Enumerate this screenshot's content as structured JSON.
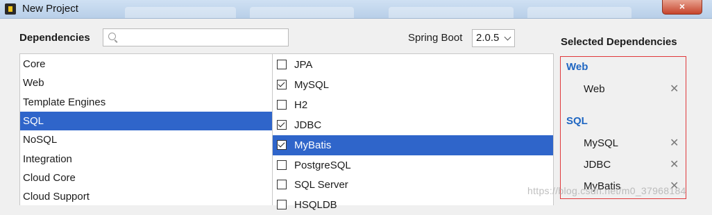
{
  "window": {
    "title": "New Project",
    "close_glyph": "×"
  },
  "header": {
    "dependencies_label": "Dependencies",
    "search": {
      "placeholder": "",
      "value": ""
    },
    "spring_boot_label": "Spring Boot",
    "spring_boot_version": "2.0.5"
  },
  "categories": [
    {
      "label": "Core",
      "selected": false
    },
    {
      "label": "Web",
      "selected": false
    },
    {
      "label": "Template Engines",
      "selected": false
    },
    {
      "label": "SQL",
      "selected": true
    },
    {
      "label": "NoSQL",
      "selected": false
    },
    {
      "label": "Integration",
      "selected": false
    },
    {
      "label": "Cloud Core",
      "selected": false
    },
    {
      "label": "Cloud Support",
      "selected": false
    }
  ],
  "dependencies": [
    {
      "label": "JPA",
      "checked": false,
      "selected": false
    },
    {
      "label": "MySQL",
      "checked": true,
      "selected": false
    },
    {
      "label": "H2",
      "checked": false,
      "selected": false
    },
    {
      "label": "JDBC",
      "checked": true,
      "selected": false
    },
    {
      "label": "MyBatis",
      "checked": true,
      "selected": true
    },
    {
      "label": "PostgreSQL",
      "checked": false,
      "selected": false
    },
    {
      "label": "SQL Server",
      "checked": false,
      "selected": false
    },
    {
      "label": "HSQLDB",
      "checked": false,
      "selected": false
    }
  ],
  "selected_panel": {
    "title": "Selected Dependencies",
    "groups": [
      {
        "name": "Web",
        "items": [
          "Web"
        ]
      },
      {
        "name": "SQL",
        "items": [
          "MySQL",
          "JDBC",
          "MyBatis"
        ]
      }
    ],
    "remove_glyph": "✕"
  },
  "watermark": "https://blog.csdn.net/m0_37968184",
  "colors": {
    "selection": "#2f65ca",
    "group_heading": "#1f66c2",
    "highlight_border": "#e0383b"
  }
}
